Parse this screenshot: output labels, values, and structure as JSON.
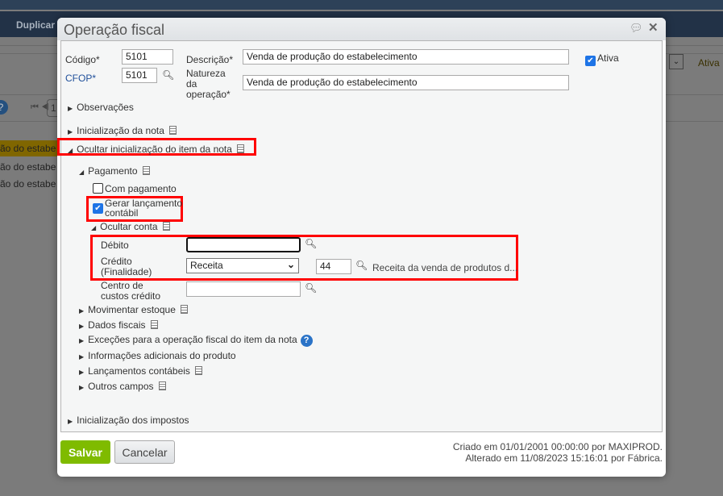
{
  "background": {
    "toolbar_label": "Duplicar",
    "rows": [
      "ão do estabe",
      "ão do estabe",
      "ão do estabe"
    ],
    "ativa_label": "Ativa",
    "page": "1"
  },
  "dialog": {
    "title": "Operação fiscal",
    "codigo": {
      "label": "Código*",
      "value": "5101"
    },
    "cfop": {
      "label": "CFOP*",
      "value": "5101"
    },
    "descricao": {
      "label": "Descrição*",
      "value": "Venda de produção do estabelecimento"
    },
    "natureza": {
      "label": "Natureza da operação*",
      "value": "Venda de produção do estabelecimento"
    },
    "ativa": {
      "label": "Ativa",
      "checked": true
    },
    "sections": {
      "observacoes": "Observações",
      "inicializacao_nota": "Inicialização da nota",
      "ocultar_item": "Ocultar inicialização do item da nota",
      "pagamento": "Pagamento",
      "com_pagamento": "Com pagamento",
      "gerar_lancamento": "Gerar lançamento contábil",
      "ocultar_conta": "Ocultar conta",
      "movimentar_estoque": "Movimentar estoque",
      "dados_fiscais": "Dados fiscais",
      "excecoes": "Exceções para a operação fiscal do item da nota",
      "informacoes": "Informações adicionais do produto",
      "lancamentos": "Lançamentos contábeis",
      "outros": "Outros campos",
      "impostos": "Inicialização dos impostos"
    },
    "debito": {
      "label": "Débito",
      "value": ""
    },
    "credito": {
      "label": "Crédito (Finalidade)",
      "select": "Receita",
      "code": "44",
      "description": "Receita da venda de produtos d..."
    },
    "centro": {
      "label": "Centro de custos crédito",
      "value": ""
    },
    "buttons": {
      "save": "Salvar",
      "cancel": "Cancelar"
    },
    "audit": {
      "created": "Criado em 01/01/2001 00:00:00 por MAXIPROD.",
      "modified": "Alterado em 11/08/2023 15:16:01 por Fábrica."
    }
  },
  "colors": {
    "highlight": "#ff0000",
    "save": "#7fbb00",
    "checkbox": "#1e74e6"
  }
}
